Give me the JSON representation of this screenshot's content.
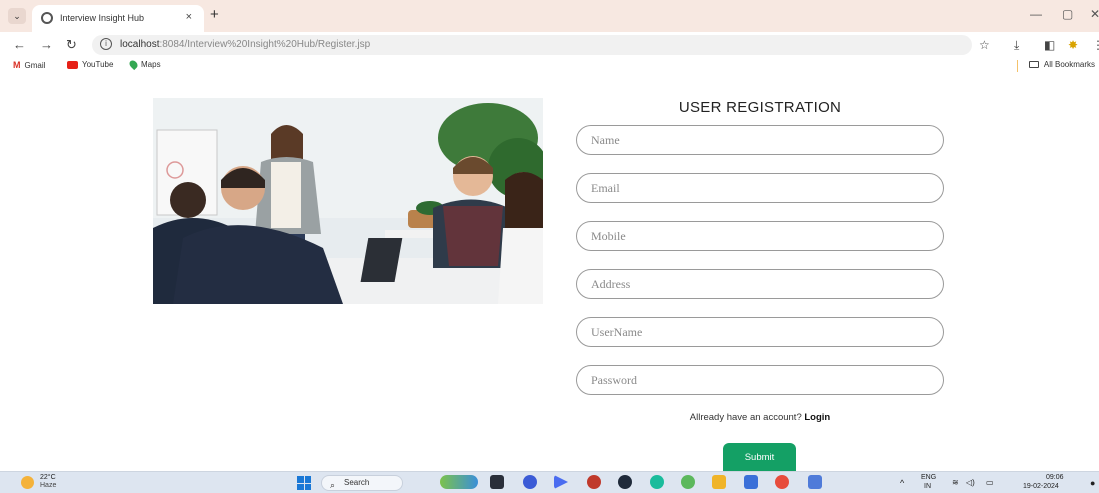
{
  "browser": {
    "tab_title": "Interview Insight Hub",
    "tab_close": "×",
    "new_tab": "+",
    "url_host": "localhost",
    "url_rest": ":8084/Interview%20Insight%20Hub/Register.jsp",
    "bookmarks": [
      {
        "label": "Gmail",
        "icon": "gmail-icon"
      },
      {
        "label": "YouTube",
        "icon": "youtube-icon"
      },
      {
        "label": "Maps",
        "icon": "maps-icon"
      }
    ],
    "all_bookmarks": "All Bookmarks"
  },
  "form": {
    "title": "USER REGISTRATION",
    "fields": [
      {
        "placeholder": "Name",
        "value": ""
      },
      {
        "placeholder": "Email",
        "value": ""
      },
      {
        "placeholder": "Mobile",
        "value": ""
      },
      {
        "placeholder": "Address",
        "value": ""
      },
      {
        "placeholder": "UserName",
        "value": ""
      },
      {
        "placeholder": "Password",
        "value": ""
      }
    ],
    "login_prompt": "Allready have an account?",
    "login_link": "Login",
    "submit_label": "Submit",
    "submit_color": "#14a065"
  },
  "hero_image": {
    "icon": "classroom-meeting-photo"
  },
  "taskbar": {
    "weather_temp": "22°C",
    "weather_condition": "Haze",
    "search_label": "Search",
    "language_line1": "ENG",
    "language_line2": "IN",
    "time": "09:06",
    "date": "19-02-2024"
  }
}
